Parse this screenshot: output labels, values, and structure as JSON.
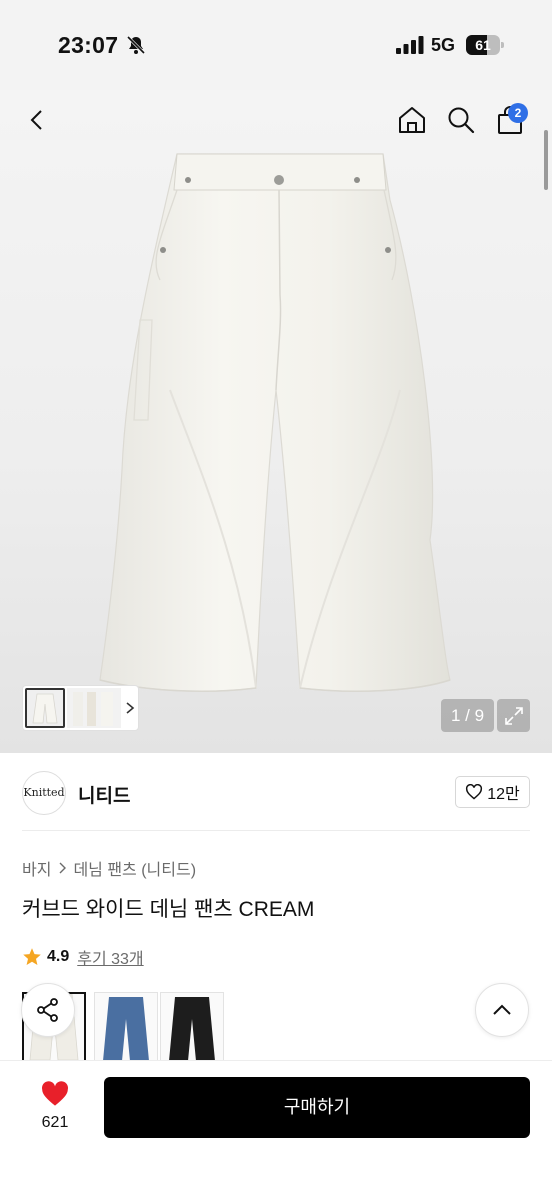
{
  "status_bar": {
    "time": "23:07",
    "network": "5G",
    "battery": "61",
    "battery_level": 0.61
  },
  "header": {
    "back_icon": "chevron-left-icon",
    "home_icon": "home-icon",
    "search_icon": "search-icon",
    "cart_icon": "shopping-bag-icon",
    "cart_count": "2"
  },
  "gallery": {
    "page_indicator": "1 / 9",
    "expand_icon": "expand-icon"
  },
  "brand": {
    "logo_text": "Knitted",
    "name": "니티드",
    "like_count": "12만"
  },
  "product": {
    "breadcrumb": [
      "바지",
      "데님 팬츠 (니티드)"
    ],
    "title": "커브드 와이드 데님 팬츠 CREAM",
    "rating": "4.9",
    "reviews": "후기 33개"
  },
  "swatches": [
    {
      "color": "#efede6",
      "selected": true
    },
    {
      "color": "#4a6fa1",
      "selected": false
    },
    {
      "color": "#1d1d1d",
      "selected": false
    }
  ],
  "bottom_bar": {
    "wish_count": "621",
    "buy_label": "구매하기"
  },
  "colors": {
    "accent_blue": "#2f6fe6",
    "heart_red": "#e8202a",
    "star": "#f5a623"
  }
}
